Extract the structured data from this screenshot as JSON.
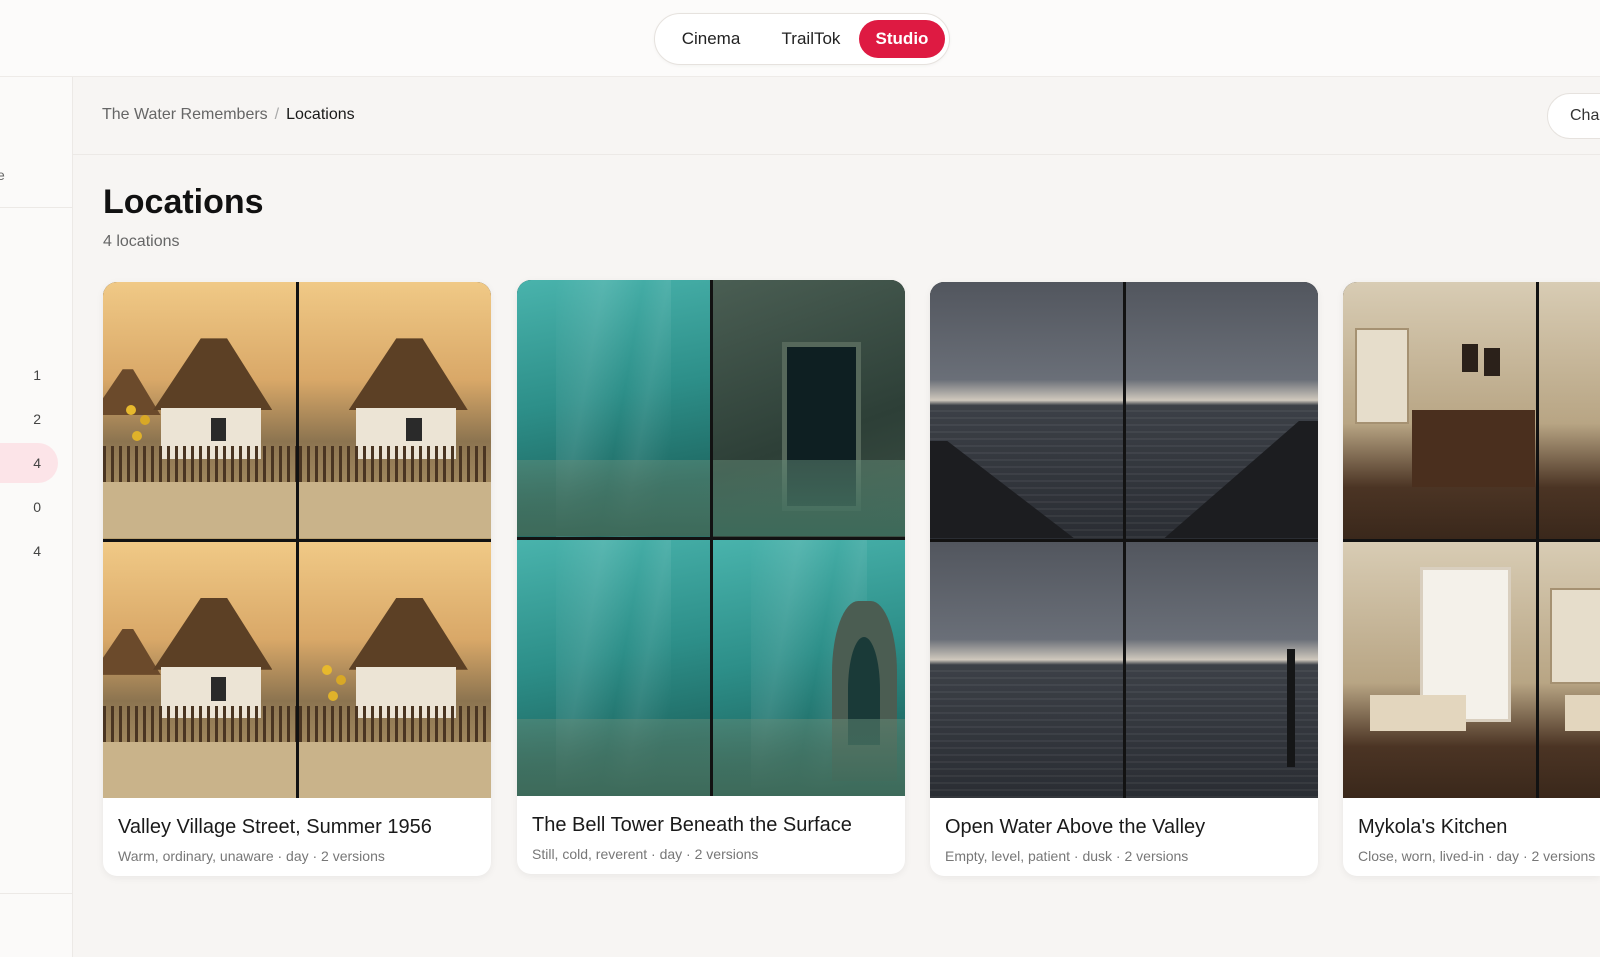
{
  "mode_switch": {
    "cinema": "Cinema",
    "trailtok": "TrailTok",
    "studio": "Studio",
    "active": "Studio"
  },
  "sidebar": {
    "fragment": "e",
    "counts": [
      {
        "value": "1",
        "active": false
      },
      {
        "value": "2",
        "active": false
      },
      {
        "value": "4",
        "active": true
      },
      {
        "value": "0",
        "active": false
      },
      {
        "value": "4",
        "active": false
      }
    ]
  },
  "breadcrumb": {
    "parent": "The Water Remembers",
    "separator": "/",
    "current": "Locations"
  },
  "header_button": {
    "label": "Cha"
  },
  "page": {
    "title": "Locations",
    "subtitle": "4 locations"
  },
  "locations": [
    {
      "title": "Valley Village Street, Summer 1956",
      "meta": "Warm, ordinary, unaware · day · 2 versions"
    },
    {
      "title": "The Bell Tower Beneath the Surface",
      "meta": "Still, cold, reverent · day · 2 versions"
    },
    {
      "title": "Open Water Above the Valley",
      "meta": "Empty, level, patient · dusk · 2 versions"
    },
    {
      "title": "Mykola's Kitchen",
      "meta": "Close, worn, lived-in · day · 2 versions"
    }
  ],
  "colors": {
    "accent": "#de1a42",
    "active_bg": "#fce4e8",
    "background": "#f7f5f3"
  }
}
